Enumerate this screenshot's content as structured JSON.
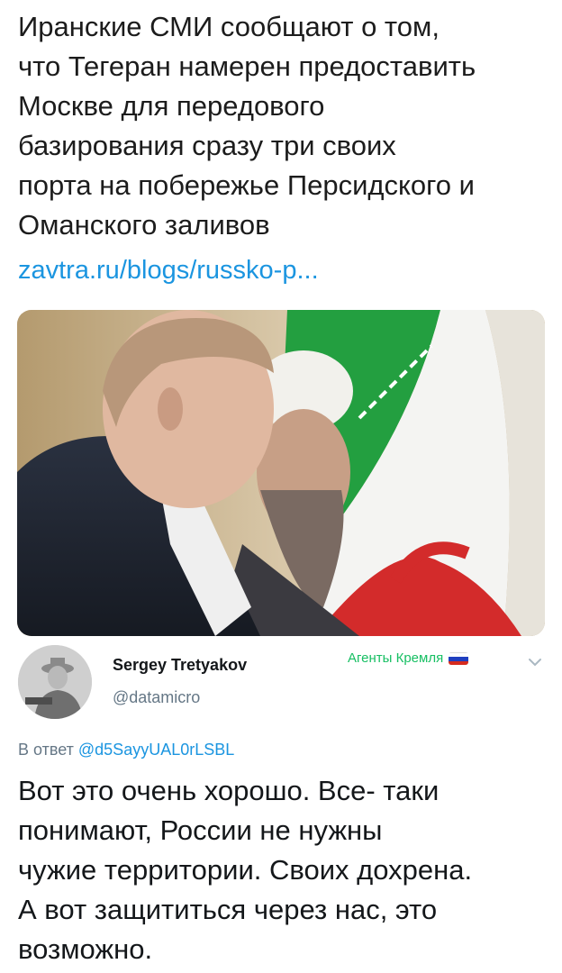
{
  "quoted_tweet": {
    "text": "Иранские СМИ сообщают о том,\nчто Тегеран намерен предоставить\nМоскве для передового\nбазирования сразу три своих\nпорта на побережье Персидского и\nОманского заливов",
    "link": "zavtra.ru/blogs/russko-p..."
  },
  "reply": {
    "author_name": "Sergey Tretyakov",
    "author_handle": "@datamicro",
    "list_badge": "Агенты Кремля",
    "reply_prefix": "В ответ ",
    "reply_mention": "@d5SayyUAL0rLSBL",
    "text": "Вот это очень хорошо. Все- таки\nпонимают, России не нужны\nчужие территории. Своих дохрена.\nА вот защититься через нас, это\nвозможно."
  },
  "colors": {
    "link": "#1b95e0",
    "badge": "#17bf63",
    "muted": "#657786"
  },
  "icons": {
    "badge_flag": "russia-flag-icon",
    "menu": "chevron-down-icon"
  }
}
